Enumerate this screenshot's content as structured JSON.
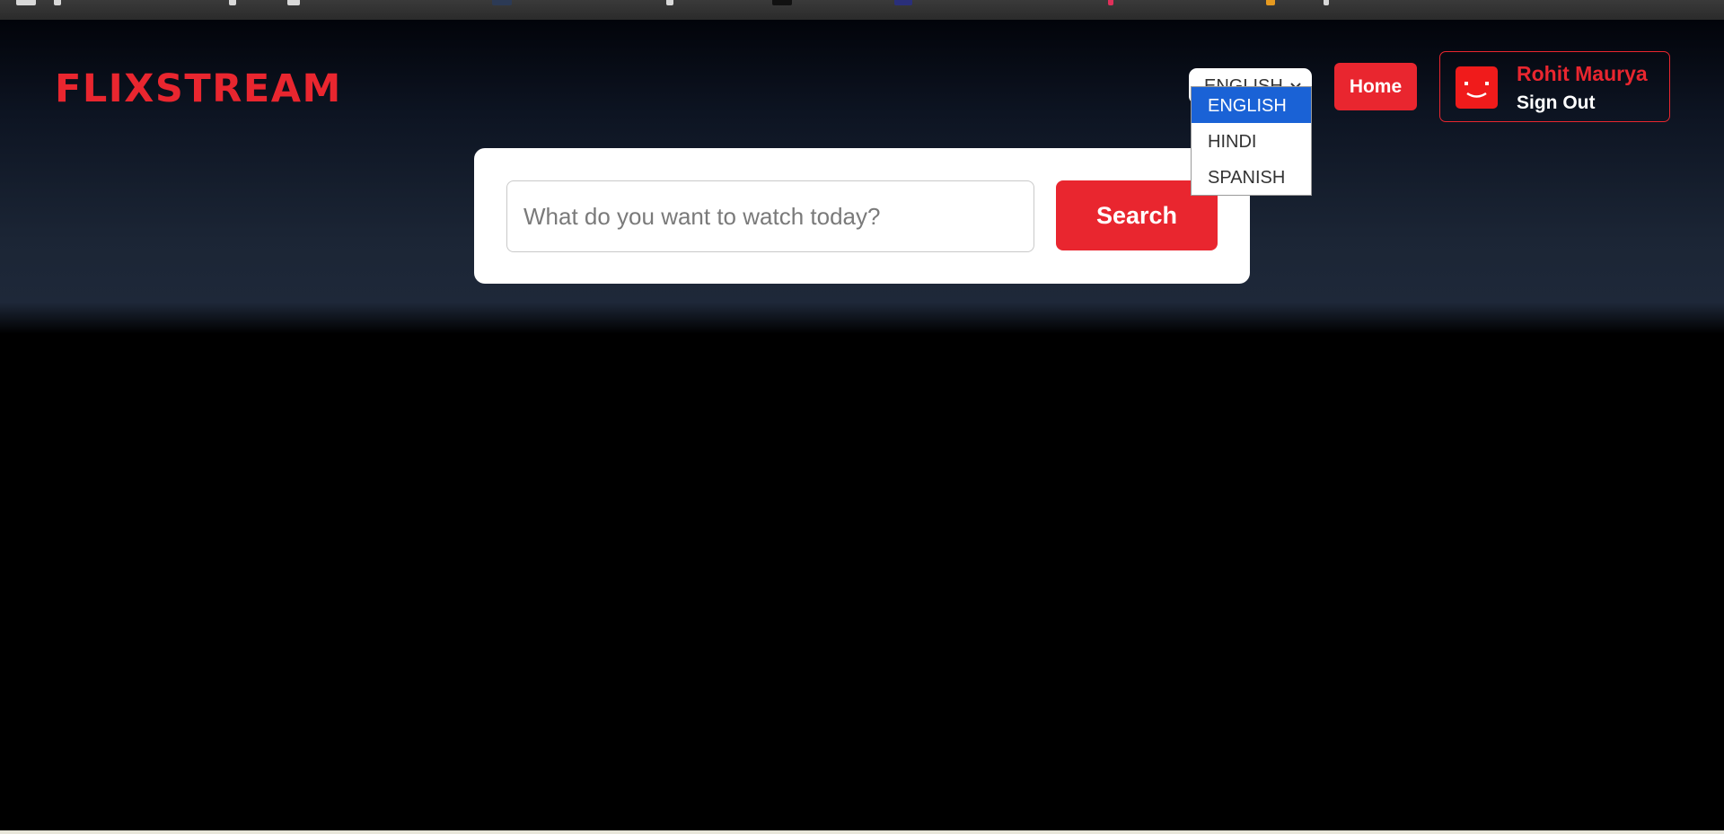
{
  "header": {
    "logo_text": "FLIXSTREAM",
    "language": {
      "selected": "ENGLISH",
      "options": [
        "ENGLISH",
        "HINDI",
        "SPANISH"
      ]
    },
    "home_label": "Home",
    "user": {
      "name": "Rohit Maurya",
      "sign_out_label": "Sign Out"
    }
  },
  "search": {
    "placeholder": "What do you want to watch today?",
    "button_label": "Search"
  },
  "colors": {
    "brand_red": "#e9262f",
    "selected_option": "#1a62d6",
    "background": "#000000"
  }
}
